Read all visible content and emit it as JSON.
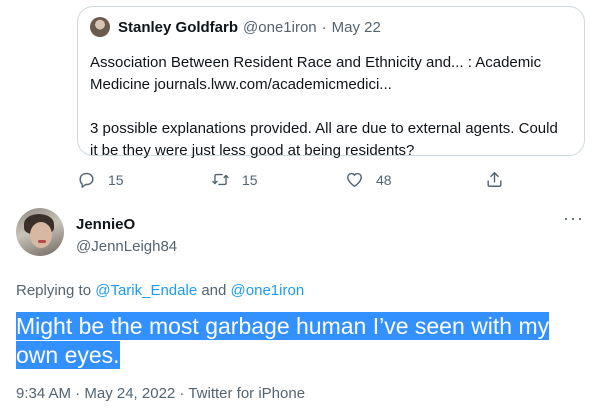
{
  "quoted_tweet": {
    "author_name": "Stanley Goldfarb",
    "author_handle": "@one1iron",
    "separator": "·",
    "date": "May 22",
    "line1": "Association Between Resident Race and Ethnicity and... : Academic",
    "line2": "Medicine journals.lww.com/academicmedici...",
    "line3": "3 possible explanations provided. All are due to external agents. Could",
    "line4": "it be they were just less good at being residents?"
  },
  "actions": {
    "reply_count": "15",
    "retweet_count": "15",
    "like_count": "48"
  },
  "reply_tweet": {
    "author_name": "JennieO",
    "author_handle": "@JennLeigh84",
    "more_label": "···",
    "replying_prefix": "Replying to ",
    "replying_user1": "@Tarik_Endale",
    "replying_and": " and ",
    "replying_user2": "@one1iron",
    "text_line1": "Might be the most garbage human I’ve seen with my",
    "text_line2": "own eyes.",
    "timestamp": "9:34 AM · May 24, 2022 · ",
    "source": "Twitter for iPhone"
  },
  "colors": {
    "link": "#1d9bf0",
    "selection_highlight": "#3390ff",
    "secondary_text": "#536471",
    "border": "#cfd9de"
  },
  "icons": [
    "reply-icon",
    "retweet-icon",
    "like-icon",
    "share-icon",
    "more-icon"
  ]
}
